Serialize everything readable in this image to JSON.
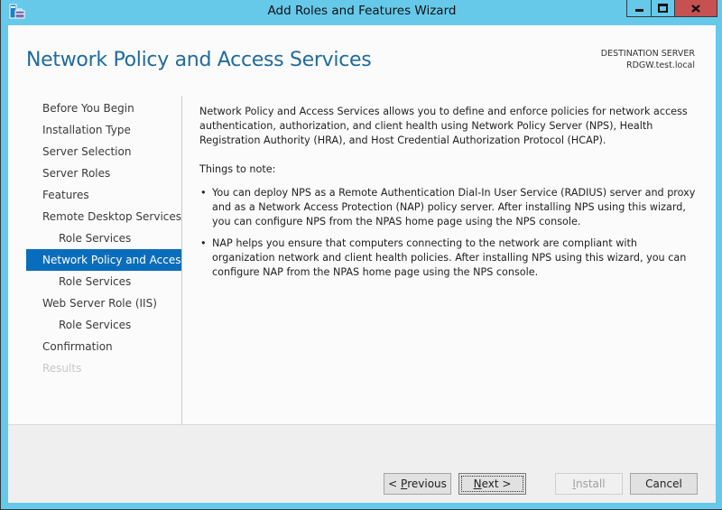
{
  "window": {
    "title": "Add Roles and Features Wizard",
    "app_icon": "server-manager-icon",
    "controls": {
      "minimize": "minimize-icon",
      "maximize": "maximize-icon",
      "close": "close-icon"
    }
  },
  "header": {
    "page_title": "Network Policy and Access Services",
    "destination_label": "DESTINATION SERVER",
    "destination_server": "RDGW.test.local"
  },
  "nav": {
    "items": [
      {
        "label": "Before You Begin",
        "level": 0,
        "state": "normal"
      },
      {
        "label": "Installation Type",
        "level": 0,
        "state": "normal"
      },
      {
        "label": "Server Selection",
        "level": 0,
        "state": "normal"
      },
      {
        "label": "Server Roles",
        "level": 0,
        "state": "normal"
      },
      {
        "label": "Features",
        "level": 0,
        "state": "normal"
      },
      {
        "label": "Remote Desktop Services",
        "level": 0,
        "state": "normal"
      },
      {
        "label": "Role Services",
        "level": 1,
        "state": "normal"
      },
      {
        "label": "Network Policy and Acces...",
        "level": 0,
        "state": "active"
      },
      {
        "label": "Role Services",
        "level": 1,
        "state": "normal"
      },
      {
        "label": "Web Server Role (IIS)",
        "level": 0,
        "state": "normal"
      },
      {
        "label": "Role Services",
        "level": 1,
        "state": "normal"
      },
      {
        "label": "Confirmation",
        "level": 0,
        "state": "normal"
      },
      {
        "label": "Results",
        "level": 0,
        "state": "disabled"
      }
    ]
  },
  "content": {
    "intro": "Network Policy and Access Services allows you to define and enforce policies for network access authentication, authorization, and client health using Network Policy Server (NPS), Health Registration Authority (HRA), and Host Credential Authorization Protocol (HCAP).",
    "notes_title": "Things to note:",
    "bullets": [
      "You can deploy NPS as a Remote Authentication Dial-In User Service (RADIUS) server and proxy and as a Network Access Protection (NAP) policy server. After installing NPS using this wizard, you can configure NPS from the NPAS home page using the NPS console.",
      "NAP helps you ensure that computers connecting to the network are compliant with organization network and client health policies. After installing NPS using this wizard, you can configure NAP from the NPAS home page using the NPS console."
    ]
  },
  "footer": {
    "previous": {
      "prefix": "< ",
      "accel": "P",
      "rest": "revious"
    },
    "next": {
      "accel": "N",
      "rest": "ext >"
    },
    "install": {
      "accel": "I",
      "rest": "nstall",
      "disabled": true
    },
    "cancel": "Cancel"
  },
  "colors": {
    "title_bar": "#66c9ea",
    "close_button": "#c75050",
    "accent": "#0a6dbb",
    "page_title": "#1f6b9e"
  }
}
